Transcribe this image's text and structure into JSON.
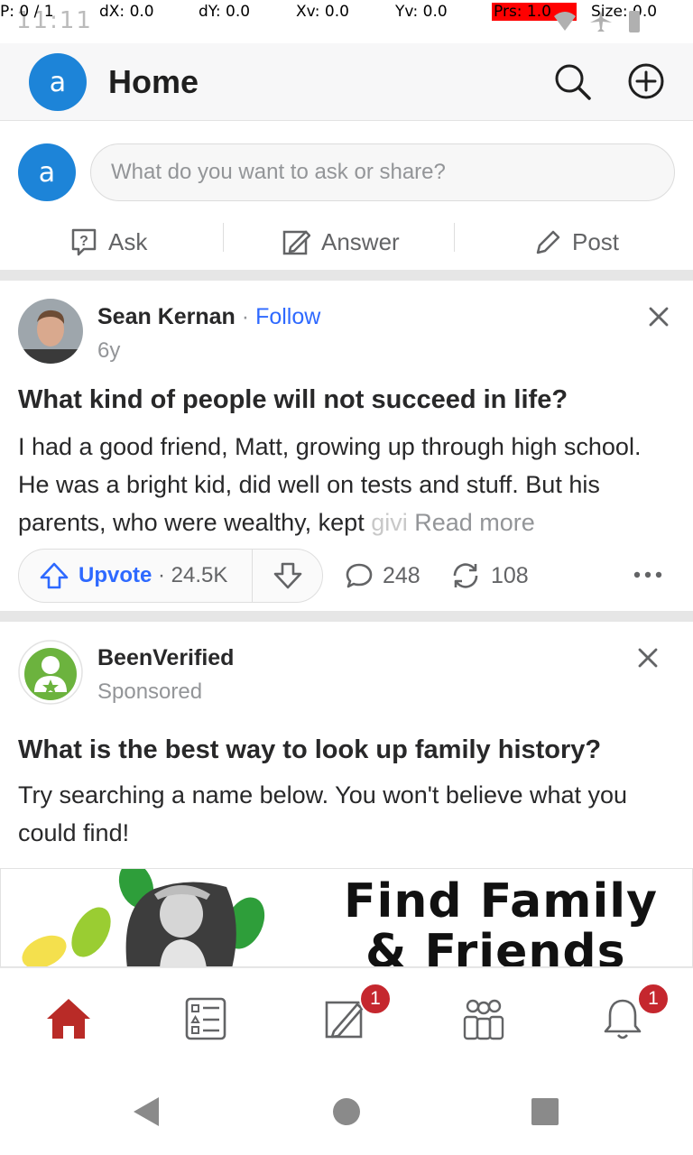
{
  "status_bar": {
    "clock": "11:11",
    "p": "P: 0 / 1",
    "dx": "dX: 0.0",
    "dy": "dY: 0.0",
    "xv": "Xv: 0.0",
    "yv": "Yv: 0.0",
    "prs": "Prs: 1.0",
    "size": "Size: 0.0"
  },
  "header": {
    "avatar_letter": "a",
    "title": "Home"
  },
  "composer": {
    "avatar_letter": "a",
    "placeholder": "What do you want to ask or share?",
    "actions": [
      {
        "label": "Ask",
        "icon": "ask-icon"
      },
      {
        "label": "Answer",
        "icon": "answer-icon"
      },
      {
        "label": "Post",
        "icon": "post-icon"
      }
    ]
  },
  "feed": {
    "post": {
      "author": "Sean Kernan",
      "separator": " · ",
      "follow_label": "Follow",
      "age": "6y",
      "question": "What kind of people will not succeed in life?",
      "body": "I had a good friend, Matt, growing up through high school. He was a bright kid, did well on tests and stuff. But his parents, who were wealthy, kept ",
      "body_fade": "givi",
      "read_more": " Read more",
      "upvote_label": "Upvote",
      "upvote_count": "· 24.5K",
      "comments": "248",
      "shares": "108"
    },
    "ad": {
      "advertiser": "BeenVerified",
      "sponsored": "Sponsored",
      "question": "What is the best way to look up family history?",
      "body": "Try searching a name below. You won't believe what you could find!",
      "image_headline_1": "Find Family",
      "image_headline_2": "& Friends"
    }
  },
  "bottom_nav": {
    "items": [
      {
        "name": "home",
        "badge": ""
      },
      {
        "name": "following",
        "badge": ""
      },
      {
        "name": "answer",
        "badge": "1"
      },
      {
        "name": "spaces",
        "badge": ""
      },
      {
        "name": "notifications",
        "badge": "1"
      }
    ]
  },
  "colors": {
    "brand_red": "#b92b27",
    "link_blue": "#2e69ff",
    "avatar_blue": "#1d84d8",
    "badge_red": "#c5272e"
  }
}
